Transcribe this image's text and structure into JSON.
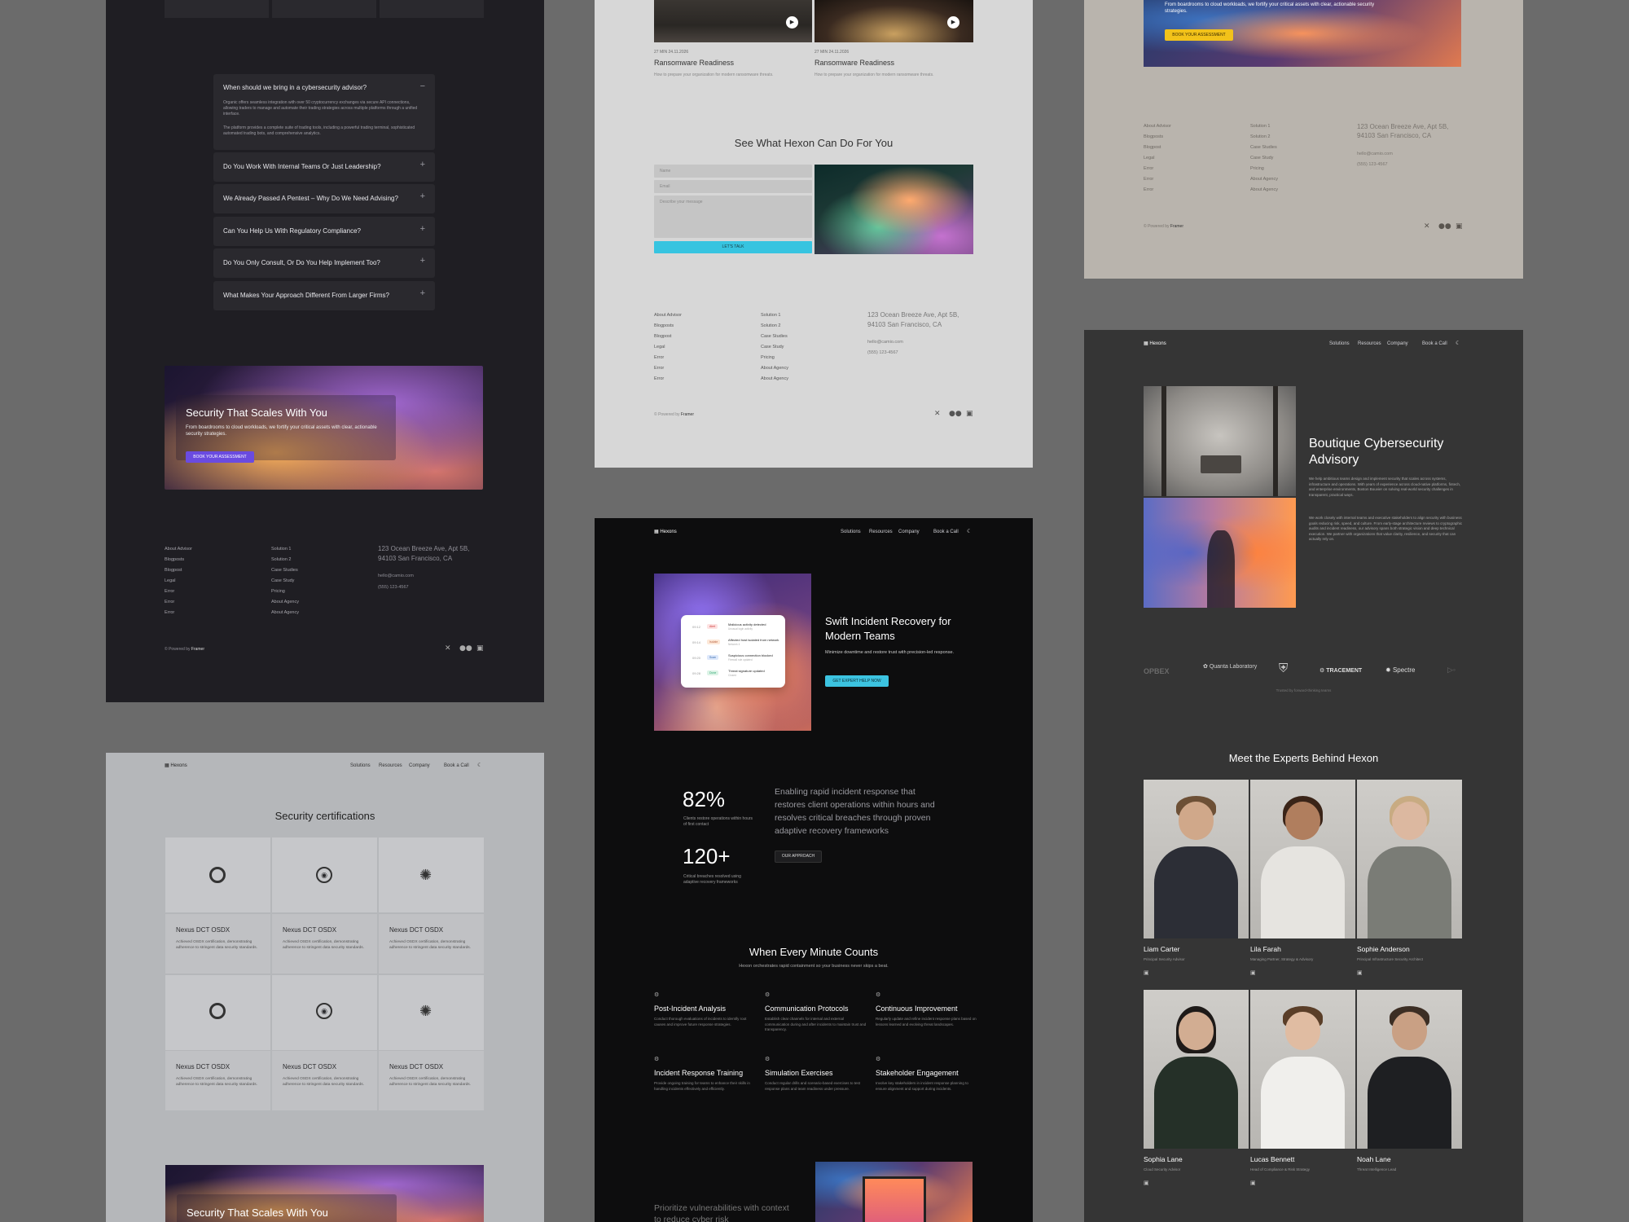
{
  "panel1": {
    "faq_open_q": "When should we bring in a cybersecurity advisor?",
    "faq_open_a1": "Organic offers seamless integration with over 50 cryptocurrency exchanges via secure API connections, allowing traders to manage and automate their trading strategies across multiple platforms through a unified interface.",
    "faq_open_a2": "The platform provides a complete suite of trading tools, including a powerful trading terminal, sophisticated automated trading bots, and comprehensive analytics.",
    "faq_items": [
      "Do You Work With Internal Teams Or Just Leadership?",
      "We Already Passed A Pentest – Why Do We Need Advising?",
      "Can You Help Us With Regulatory Compliance?",
      "Do You Only Consult, Or Do You Help Implement Too?",
      "What Makes Your Approach Different From Larger Firms?"
    ],
    "cta_title": "Security That Scales With You",
    "cta_text": "From boardrooms to cloud workloads, we fortify your critical assets with clear, actionable security strategies.",
    "cta_button": "BOOK YOUR ASSESSMENT",
    "footer_col1": [
      "About Advisor",
      "Blogposts",
      "Blogpost",
      "Legal",
      "Error",
      "Error",
      "Error"
    ],
    "footer_col2": [
      "Solution 1",
      "Solution 2",
      "Case Studies",
      "Case Study",
      "Pricing",
      "About Agency",
      "About Agency"
    ],
    "address1": "123 Ocean Breeze Ave, Apt 5B,",
    "address2": "94103 San Francisco, CA",
    "email": "hello@camio.com",
    "phone": "(555) 123-4567",
    "powered": "© Powered by",
    "powered_brand": "Framer"
  },
  "panel2": {
    "cards": [
      {
        "meta": "27 MIN    24.11.2026",
        "title": "Ransomware Readiness",
        "desc": "How to prepare your organization for modern ransomware threats."
      },
      {
        "meta": "27 MIN    24.11.2026",
        "title": "Ransomware Readiness",
        "desc": "How to prepare your organization for modern ransomware threats."
      }
    ],
    "section_title": "See What Hexon Can Do For You",
    "name_ph": "Name",
    "email_ph": "Email",
    "msg_ph": "Describe your message",
    "submit": "LET'S TALK",
    "footer_col1": [
      "About Advisor",
      "Blogposts",
      "Blogpost",
      "Legal",
      "Error",
      "Error",
      "Error"
    ],
    "footer_col2": [
      "Solution 1",
      "Solution 2",
      "Case Studies",
      "Case Study",
      "Pricing",
      "About Agency",
      "About Agency"
    ],
    "address1": "123 Ocean Breeze Ave, Apt 5B,",
    "address2": "94103 San Francisco, CA",
    "email": "hello@camio.com",
    "phone": "(555) 123-4567",
    "powered": "© Powered by",
    "powered_brand": "Framer"
  },
  "panel3": {
    "cta_text": "From boardrooms to cloud workloads, we fortify your critical assets with clear, actionable security strategies.",
    "cta_button": "BOOK YOUR ASSESSMENT",
    "footer_col1": [
      "About Advisor",
      "Blogposts",
      "Blogpost",
      "Legal",
      "Error",
      "Error",
      "Error"
    ],
    "footer_col2": [
      "Solution 1",
      "Solution 2",
      "Case Studies",
      "Case Study",
      "Pricing",
      "About Agency",
      "About Agency"
    ],
    "address1": "123 Ocean Breeze Ave, Apt 5B,",
    "address2": "94103 San Francisco, CA",
    "email": "hello@camio.com",
    "phone": "(555) 123-4567",
    "powered": "© Powered by",
    "powered_brand": "Framer"
  },
  "panel4": {
    "logo": "Hexons",
    "nav": [
      "Solutions",
      "Resources",
      "Company"
    ],
    "nav_cta": "Book a Call",
    "title": "Security certifications",
    "cert_name": "Nexus DCT OSDX",
    "cert_desc": "Achieved OSDX certification, demonstrating adherence to stringent data security standards.",
    "cta_title": "Security That Scales With You"
  },
  "panel5": {
    "logo": "Hexons",
    "nav": [
      "Solutions",
      "Resources",
      "Company"
    ],
    "nav_cta": "Book a Call",
    "hero_title": "Swift Incident Recovery for Modern Teams",
    "hero_text": "Minimize downtime and restore trust with precision-led response.",
    "hero_button": "GET EXPERT HELP NOW",
    "mock_rows": [
      {
        "time": "09:12",
        "tag": "Alert",
        "title": "Malicious activity detected",
        "sub": "Unusual login activity"
      },
      {
        "time": "09:14",
        "tag": "Isolate",
        "title": "Affected host isolated from network",
        "sub": "Network 4"
      },
      {
        "time": "09:20",
        "tag": "Scan",
        "title": "Suspicious connection blocked",
        "sub": "Firewall rule updated"
      },
      {
        "time": "09:28",
        "tag": "Done",
        "title": "Threat signature updated",
        "sub": "Closed"
      }
    ],
    "stat1": "82%",
    "stat1_label": "Clients restore operations within hours of first contact",
    "stat2": "120+",
    "stat2_label": "Critical breaches resolved using adaptive recovery frameworks",
    "stat_text": "Enabling rapid incident response that restores client operations within hours and resolves critical breaches through proven adaptive recovery frameworks",
    "stat_button": "OUR APPROACH",
    "section_title": "When Every Minute Counts",
    "section_sub": "Hexon orchestrates rapid containment so your business never skips a beat.",
    "features": [
      {
        "title": "Post-Incident Analysis",
        "text": "Conduct thorough evaluations of incidents to identify root causes and improve future response strategies."
      },
      {
        "title": "Communication Protocols",
        "text": "Establish clear channels for internal and external communication during and after incidents to maintain trust and transparency."
      },
      {
        "title": "Continuous Improvement",
        "text": "Regularly update and refine incident response plans based on lessons learned and evolving threat landscapes."
      },
      {
        "title": "Incident Response Training",
        "text": "Provide ongoing training for teams to enhance their skills in handling incidents effectively and efficiently."
      },
      {
        "title": "Simulation Exercises",
        "text": "Conduct regular drills and scenario-based exercises to test response plans and team readiness under pressure."
      },
      {
        "title": "Stakeholder Engagement",
        "text": "Involve key stakeholders in incident response planning to ensure alignment and support during incidents."
      }
    ],
    "bottom_text": "Prioritize vulnerabilities with context to reduce cyber risk"
  },
  "panel6": {
    "logo": "Hexons",
    "nav": [
      "Solutions",
      "Resources",
      "Company"
    ],
    "nav_cta": "Book a Call",
    "title": "Boutique Cybersecurity Advisory",
    "para1": "We help ambitious teams design and implement security that scales across systems, infrastructure and operations. With years of experience across cloud-native platforms, fintech, and enterprise environments, Boston Bouvier on solving real-world security challenges in transparent, practical ways.",
    "para2": "We work closely with internal teams and executive stakeholders to align security with business goals reducing risk, speed, and culture. From early-stage architecture reviews to cryptographic audits and incident readiness, our advisory spans both strategic vision and deep technical execution. We partner with organizations that value clarity, resilience, and security that can actually rely on.",
    "logos": [
      "OPBEX",
      "Quanta Laboratory",
      "",
      "TRACEMENT",
      "Spectre",
      ""
    ],
    "logos_caption": "Trusted by forward-thinking teams",
    "team_title": "Meet the Experts Behind Hexon",
    "team": [
      {
        "name": "Liam Carter",
        "role": "Principal Security Advisor"
      },
      {
        "name": "Lila Farah",
        "role": "Managing Partner, Strategy & Advisory"
      },
      {
        "name": "Sophie Anderson",
        "role": "Principal Infrastructure Security Architect"
      },
      {
        "name": "Sophia Lane",
        "role": "Cloud Security Advisor"
      },
      {
        "name": "Lucas Bennett",
        "role": "Head of Compliance & Risk Strategy"
      },
      {
        "name": "Noah Lane",
        "role": "Threat Intelligence Lead"
      }
    ]
  }
}
